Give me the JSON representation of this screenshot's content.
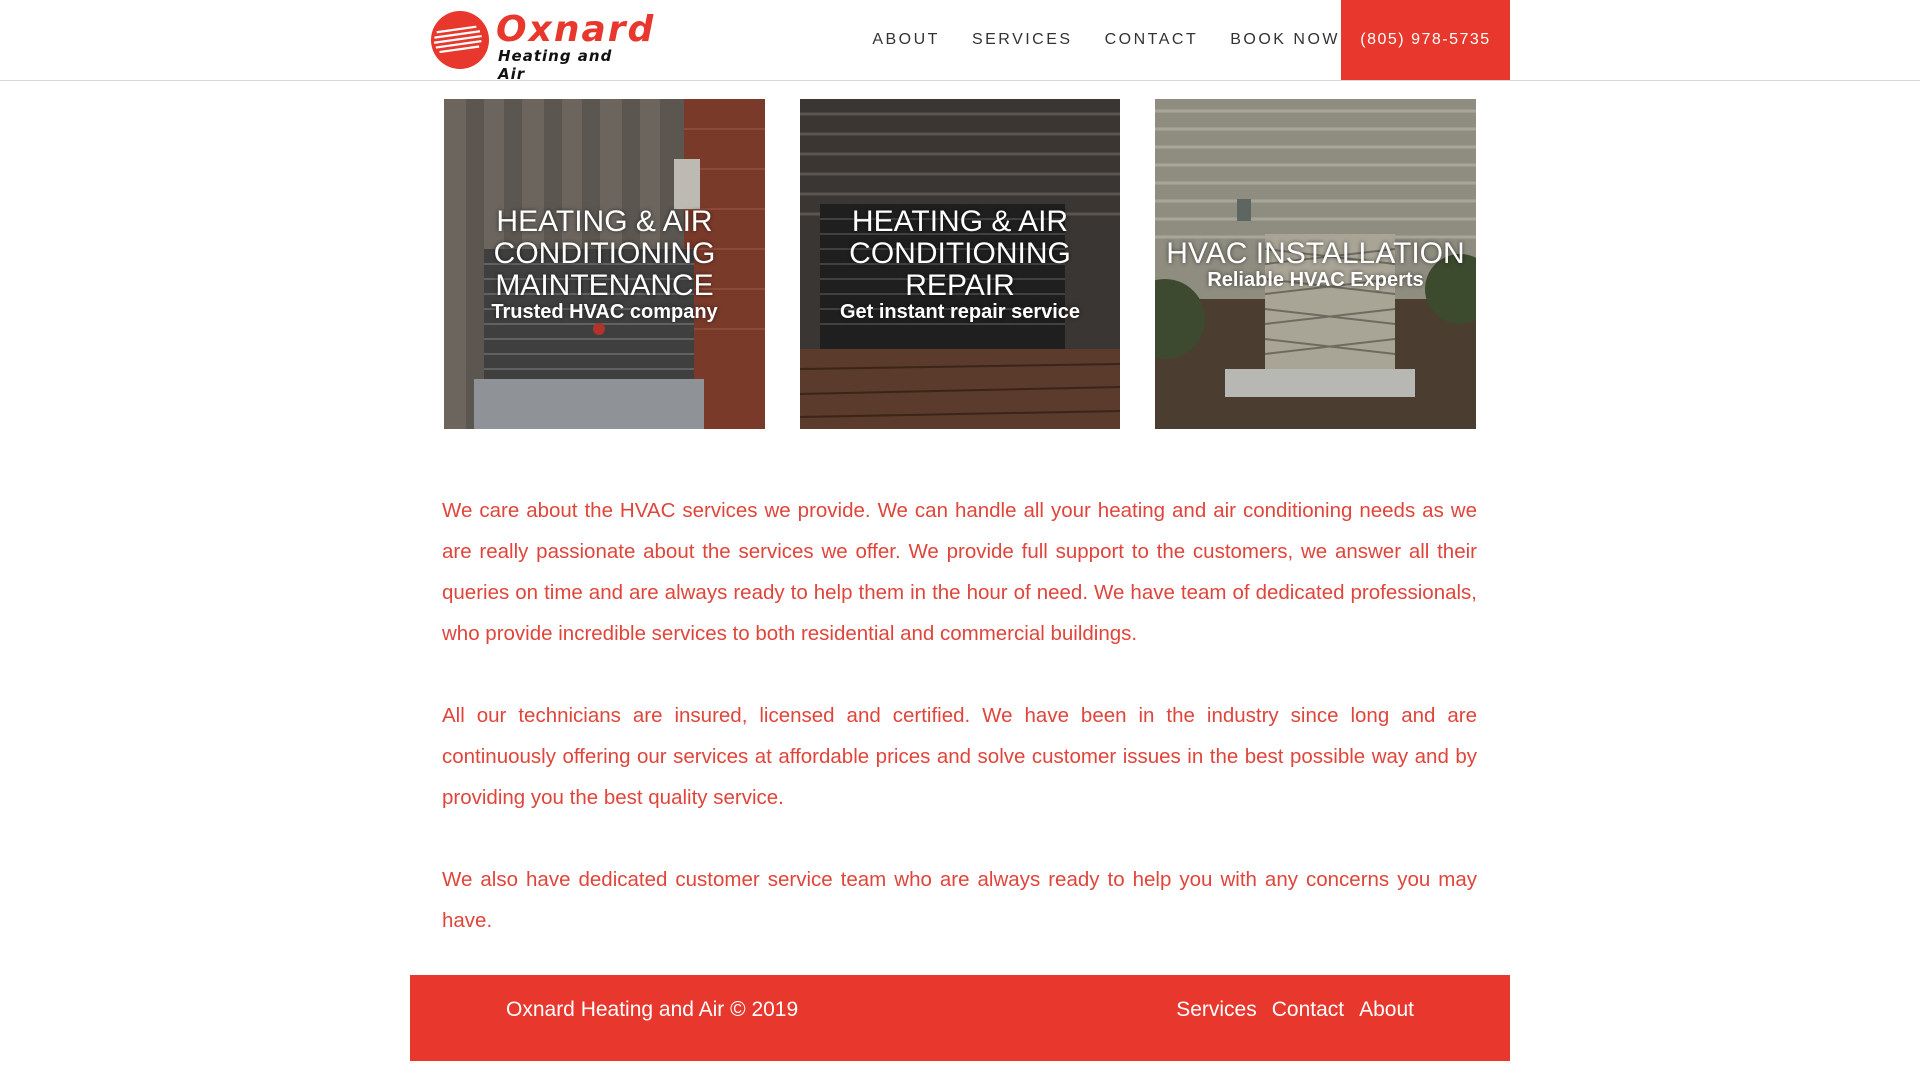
{
  "brand": {
    "name": "Oxnard",
    "tagline": "Heating and Air",
    "color": "#e8372c"
  },
  "nav": {
    "items": [
      "ABOUT",
      "SERVICES",
      "CONTACT",
      "BOOK NOW"
    ],
    "phone": "(805) 978-5735"
  },
  "cards": [
    {
      "title_lines": [
        "HEATING & AIR",
        "CONDITIONING",
        "MAINTENANCE"
      ],
      "subtitle": "Trusted HVAC company"
    },
    {
      "title_lines": [
        "HEATING & AIR",
        "CONDITIONING",
        "REPAIR"
      ],
      "subtitle": "Get instant repair service"
    },
    {
      "title_lines": [
        "HVAC INSTALLATION"
      ],
      "subtitle": "Reliable HVAC Experts"
    }
  ],
  "content": {
    "paragraphs": [
      "We care about the HVAC services we provide. We can handle all your heating and air conditioning needs as we are really passionate about the services we offer. We provide full support to the customers, we answer all their queries on time and are always ready to help them in the hour of need. We have team of dedicated professionals, who provide incredible services to both residential and commercial buildings.",
      "All our technicians are insured, licensed and certified. We have been in the industry since long and are continuously offering our services at affordable prices and solve customer issues in the best possible way and by providing you the best quality service.",
      "We also have dedicated customer service team who are always ready to help you with any concerns you may have."
    ]
  },
  "footer": {
    "copyright": "Oxnard Heating and Air © 2019",
    "links": [
      "Services",
      "Contact",
      "About"
    ]
  }
}
